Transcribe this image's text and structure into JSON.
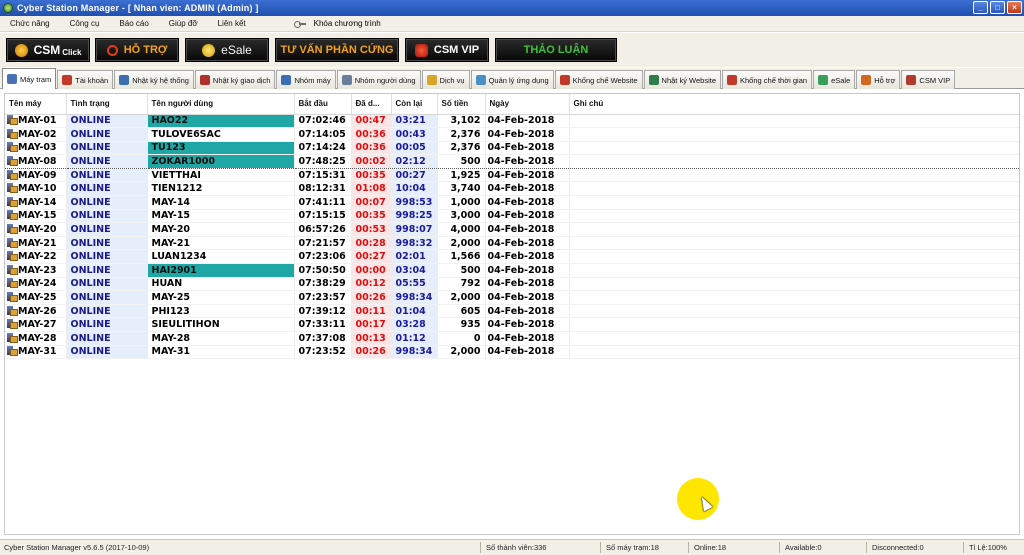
{
  "window": {
    "title": "Cyber Station Manager - [ Nhan vien: ADMIN (Admin) ]",
    "buttons": {
      "minimize": "_",
      "maximize": "□",
      "close": "×"
    }
  },
  "menu": {
    "items": [
      "Chức năng",
      "Công cụ",
      "Báo cáo",
      "Giúp đỡ",
      "Liên kết"
    ],
    "lock_label": "Khóa chương trình"
  },
  "toolbar": {
    "csm_label": "CSM",
    "csm_small": "Click",
    "hotro_label": "HỖ TRỢ",
    "esale_label": "eSale",
    "tuvan_label": "TƯ VẤN PHẦN CỨNG",
    "vip_label": "CSM VIP",
    "thaoluan_label": "THẢO LUẬN"
  },
  "tabs": [
    {
      "label": "Máy trạm",
      "icon": "computer-icon",
      "color": "#4a6fb5"
    },
    {
      "label": "Tài khoản",
      "icon": "account-icon",
      "color": "#c0392b"
    },
    {
      "label": "Nhật ký hệ thống",
      "icon": "system-log-icon",
      "color": "#3d6fb0"
    },
    {
      "label": "Nhật ký giao dịch",
      "icon": "transaction-log-icon",
      "color": "#b0302a"
    },
    {
      "label": "Nhóm máy",
      "icon": "machine-group-icon",
      "color": "#3b6fb5"
    },
    {
      "label": "Nhóm người dùng",
      "icon": "user-group-icon",
      "color": "#6a7d9a"
    },
    {
      "label": "Dịch vụ",
      "icon": "service-icon",
      "color": "#d7a52a"
    },
    {
      "label": "Quản lý ứng dụng",
      "icon": "app-manager-icon",
      "color": "#4a8fc6"
    },
    {
      "label": "Khống chế Website",
      "icon": "block-website-icon",
      "color": "#c0392b"
    },
    {
      "label": "Nhật ký Website",
      "icon": "website-log-icon",
      "color": "#2f7d4a"
    },
    {
      "label": "Khống chế thời gian",
      "icon": "time-control-icon",
      "color": "#c0392b"
    },
    {
      "label": "eSale",
      "icon": "esale-icon",
      "color": "#3a9e5c"
    },
    {
      "label": "Hỗ trợ",
      "icon": "support-icon",
      "color": "#d2691e"
    },
    {
      "label": "CSM VIP",
      "icon": "vip-icon",
      "color": "#b03a2e"
    }
  ],
  "grid": {
    "columns": [
      "Tên máy",
      "Tình trạng",
      "Tên người dùng",
      "Bắt đầu",
      "Đã d...",
      "Còn lại",
      "Số tiền",
      "Ngày",
      "Ghi chú"
    ],
    "rows": [
      {
        "machine": "MAY-01",
        "status": "ONLINE",
        "user": "HAO22",
        "start": "07:02:46",
        "used": "00:47",
        "remain": "03:21",
        "money": "3,102",
        "date": "04-Feb-2018",
        "note": "",
        "highlight": true
      },
      {
        "machine": "MAY-02",
        "status": "ONLINE",
        "user": "TULOVE6SAC",
        "start": "07:14:05",
        "used": "00:36",
        "remain": "00:43",
        "money": "2,376",
        "date": "04-Feb-2018",
        "note": "",
        "highlight": false
      },
      {
        "machine": "MAY-03",
        "status": "ONLINE",
        "user": "TU123",
        "start": "07:14:24",
        "used": "00:36",
        "remain": "00:05",
        "money": "2,376",
        "date": "04-Feb-2018",
        "note": "",
        "highlight": true
      },
      {
        "machine": "MAY-08",
        "status": "ONLINE",
        "user": "ZOKAR1000",
        "start": "07:48:25",
        "used": "00:02",
        "remain": "02:12",
        "money": "500",
        "date": "04-Feb-2018",
        "note": "",
        "highlight": true,
        "selected": true
      },
      {
        "machine": "MAY-09",
        "status": "ONLINE",
        "user": "VIETTHAI",
        "start": "07:15:31",
        "used": "00:35",
        "remain": "00:27",
        "money": "1,925",
        "date": "04-Feb-2018",
        "note": "",
        "highlight": false
      },
      {
        "machine": "MAY-10",
        "status": "ONLINE",
        "user": "TIEN1212",
        "start": "08:12:31",
        "used": "01:08",
        "remain": "10:04",
        "money": "3,740",
        "date": "04-Feb-2018",
        "note": "",
        "highlight": false
      },
      {
        "machine": "MAY-14",
        "status": "ONLINE",
        "user": "MAY-14",
        "start": "07:41:11",
        "used": "00:07",
        "remain": "998:53",
        "money": "1,000",
        "date": "04-Feb-2018",
        "note": "",
        "highlight": false
      },
      {
        "machine": "MAY-15",
        "status": "ONLINE",
        "user": "MAY-15",
        "start": "07:15:15",
        "used": "00:35",
        "remain": "998:25",
        "money": "3,000",
        "date": "04-Feb-2018",
        "note": "",
        "highlight": false
      },
      {
        "machine": "MAY-20",
        "status": "ONLINE",
        "user": "MAY-20",
        "start": "06:57:26",
        "used": "00:53",
        "remain": "998:07",
        "money": "4,000",
        "date": "04-Feb-2018",
        "note": "",
        "highlight": false
      },
      {
        "machine": "MAY-21",
        "status": "ONLINE",
        "user": "MAY-21",
        "start": "07:21:57",
        "used": "00:28",
        "remain": "998:32",
        "money": "2,000",
        "date": "04-Feb-2018",
        "note": "",
        "highlight": false
      },
      {
        "machine": "MAY-22",
        "status": "ONLINE",
        "user": "LUAN1234",
        "start": "07:23:06",
        "used": "00:27",
        "remain": "02:01",
        "money": "1,566",
        "date": "04-Feb-2018",
        "note": "",
        "highlight": false
      },
      {
        "machine": "MAY-23",
        "status": "ONLINE",
        "user": "HAI2901",
        "start": "07:50:50",
        "used": "00:00",
        "remain": "03:04",
        "money": "500",
        "date": "04-Feb-2018",
        "note": "",
        "highlight": true
      },
      {
        "machine": "MAY-24",
        "status": "ONLINE",
        "user": "HUAN",
        "start": "07:38:29",
        "used": "00:12",
        "remain": "05:55",
        "money": "792",
        "date": "04-Feb-2018",
        "note": "",
        "highlight": false
      },
      {
        "machine": "MAY-25",
        "status": "ONLINE",
        "user": "MAY-25",
        "start": "07:23:57",
        "used": "00:26",
        "remain": "998:34",
        "money": "2,000",
        "date": "04-Feb-2018",
        "note": "",
        "highlight": false
      },
      {
        "machine": "MAY-26",
        "status": "ONLINE",
        "user": "PHI123",
        "start": "07:39:12",
        "used": "00:11",
        "remain": "01:04",
        "money": "605",
        "date": "04-Feb-2018",
        "note": "",
        "highlight": false
      },
      {
        "machine": "MAY-27",
        "status": "ONLINE",
        "user": "SIEULITIHON",
        "start": "07:33:11",
        "used": "00:17",
        "remain": "03:28",
        "money": "935",
        "date": "04-Feb-2018",
        "note": "",
        "highlight": false
      },
      {
        "machine": "MAY-28",
        "status": "ONLINE",
        "user": "MAY-28",
        "start": "07:37:08",
        "used": "00:13",
        "remain": "01:12",
        "money": "0",
        "date": "04-Feb-2018",
        "note": "",
        "highlight": false
      },
      {
        "machine": "MAY-31",
        "status": "ONLINE",
        "user": "MAY-31",
        "start": "07:23:52",
        "used": "00:26",
        "remain": "998:34",
        "money": "2,000",
        "date": "04-Feb-2018",
        "note": "",
        "highlight": false
      }
    ]
  },
  "statusbar": {
    "version": "Cyber Station Manager v5.6.5 (2017-10-09)",
    "members": "Số thành viên:336",
    "stations": "Số máy trạm:18",
    "online": "Online:18",
    "available": "Available:0",
    "disconnected": "Disconnected:0",
    "ratio": "Tỉ Lệ:100%"
  },
  "colors": {
    "highlight_user": "#1fa7a6",
    "status_text": "#1a1a8a",
    "used_text": "#e00d0d",
    "cursor_halo": "#ffe600"
  }
}
